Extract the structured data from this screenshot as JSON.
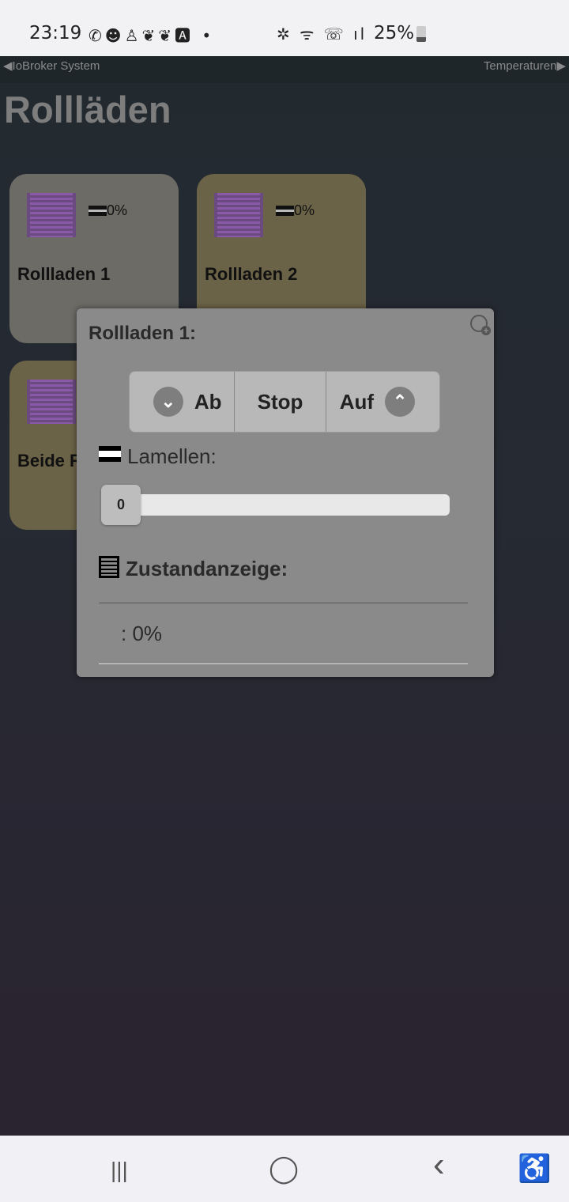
{
  "status": {
    "time": "23:19",
    "battery": "25%",
    "icons": [
      "whatsapp-icon",
      "smiley-icon",
      "person-icon",
      "heart-icon",
      "heart-megaphone-icon",
      "font-icon",
      "dot-icon",
      "bluetooth-icon",
      "wifi-icon",
      "wifi-call-icon",
      "signal-icon",
      "battery-icon"
    ]
  },
  "nav": {
    "prev": "IoBroker System",
    "next": "Temperaturen"
  },
  "page": {
    "title": "Rollläden"
  },
  "cards": [
    {
      "name": "Rollladen 1",
      "value": "0%",
      "color": "#6d6b66"
    },
    {
      "name": "Rollladen 2",
      "value": "0%",
      "color": "#6b6347"
    },
    {
      "name": "Beide R",
      "color": "#6b6347"
    }
  ],
  "popup": {
    "title": "Rollladen 1:",
    "buttons": {
      "down": "Ab",
      "stop": "Stop",
      "up": "Auf"
    },
    "lamellen_label": "Lamellen:",
    "slider_value": "0",
    "status_label": "Zustandanzeige:",
    "status_value": ": 0%"
  },
  "navbar": {
    "recent": "|||",
    "home": "◯",
    "back": "‹",
    "accessibility": "♿"
  }
}
